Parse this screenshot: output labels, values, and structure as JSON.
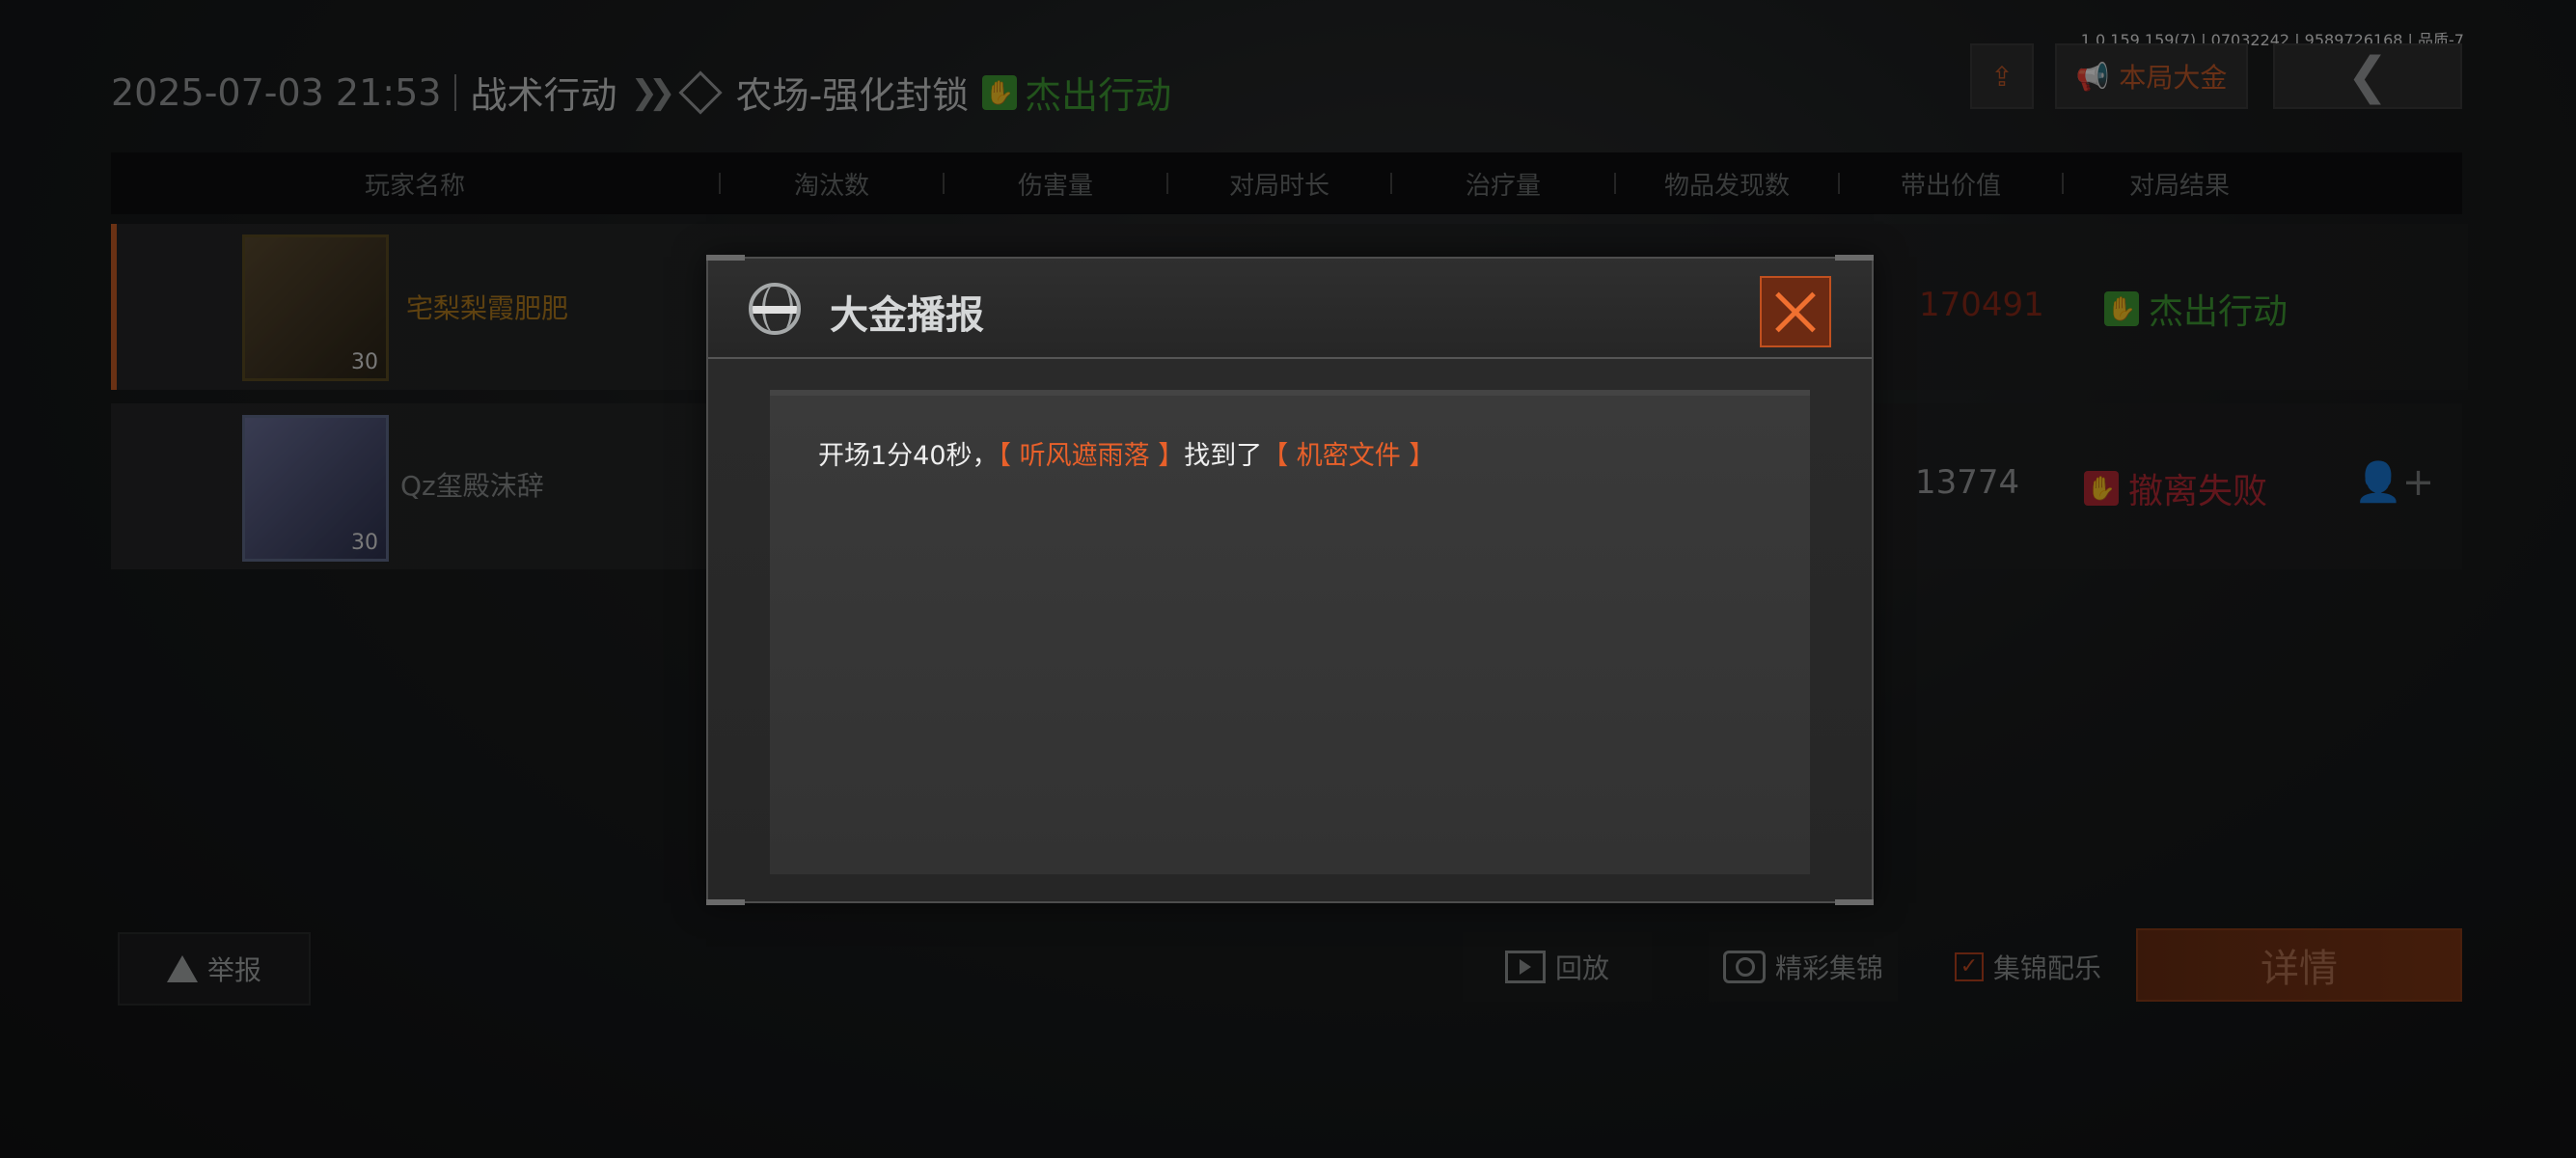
{
  "version": "1.0.159.159(7) | 07032242 | 9589726168 | 品质-7",
  "header": {
    "datetime": "2025-07-03 21:53",
    "mode": "战术行动",
    "arrows": "❯❯",
    "map": "农场-强化封锁",
    "result": "杰出行动"
  },
  "top_buttons": {
    "share_icon": "share-icon",
    "gold_label": "本局大金",
    "back_icon": "back-chevron-icon"
  },
  "table": {
    "columns": [
      "玩家名称",
      "淘汰数",
      "伤害量",
      "对局时长",
      "治疗量",
      "物品发现数",
      "带出价值",
      "对局结果"
    ],
    "rows": [
      {
        "name": "宅梨梨霞肥肥",
        "level": "30",
        "value": "170491",
        "result": "杰出行动",
        "result_color": "#3f9b35"
      },
      {
        "name": "Qz玺殿沫辞",
        "level": "30",
        "value": "13774",
        "result": "撤离失败",
        "result_color": "#b52a35"
      }
    ]
  },
  "bottom": {
    "report": "举报",
    "replay": "回放",
    "highlight": "精彩集锦",
    "music": "集锦配乐",
    "music_checked": true,
    "detail": "详情"
  },
  "modal": {
    "title": "大金播报",
    "message": {
      "prefix": "开场1分40秒，",
      "player": "【 听风遮雨落 】",
      "middle": "找到了",
      "item": "【 机密文件 】"
    }
  },
  "colors": {
    "accent_orange": "#e8602a",
    "success_green": "#3f9b35",
    "fail_red": "#b52a35"
  }
}
